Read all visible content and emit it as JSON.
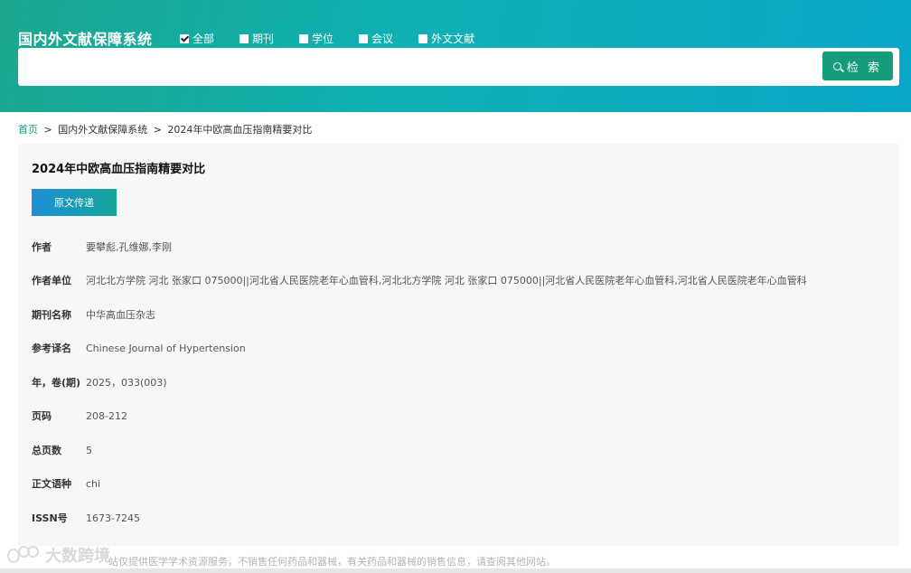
{
  "header": {
    "logo_text": "国内外文献保障系统",
    "filters": [
      {
        "label": "全部",
        "checked": true
      },
      {
        "label": "期刊",
        "checked": false
      },
      {
        "label": "学位",
        "checked": false
      },
      {
        "label": "会议",
        "checked": false
      },
      {
        "label": "外文文献",
        "checked": false
      }
    ],
    "search": {
      "value": "",
      "placeholder": "",
      "button_label": "检 索"
    }
  },
  "breadcrumb": {
    "home": "首页",
    "separator": ">",
    "level1": "国内外文献保障系统",
    "current": "2024年中欧高血压指南精要对比"
  },
  "article": {
    "title": "2024年中欧高血压指南精要对比",
    "delivery_button": "原文传递",
    "fields": [
      {
        "label": "作者",
        "value": "要攀彪,孔维娜,李刚"
      },
      {
        "label": "作者单位",
        "value": "河北北方学院 河北 张家口 075000||河北省人民医院老年心血管科,河北北方学院 河北 张家口 075000||河北省人民医院老年心血管科,河北省人民医院老年心血管科"
      },
      {
        "label": "期刊名称",
        "value": "中华高血压杂志"
      },
      {
        "label": "参考译名",
        "value": "Chinese Journal of Hypertension"
      },
      {
        "label": "年，卷(期)",
        "value": "2025，033(003)"
      },
      {
        "label": "页码",
        "value": "208-212"
      },
      {
        "label": "总页数",
        "value": "5"
      },
      {
        "label": "正文语种",
        "value": "chi"
      },
      {
        "label": "ISSN号",
        "value": "1673-7245"
      }
    ]
  },
  "footer": {
    "text": "站仅提供医学学术资源服务，不销售任何药品和器械，有关药品和器械的销售信息，请查阅其他网站。",
    "watermark": "大数跨境"
  },
  "colors": {
    "header_gradient_start": "#1aa88e",
    "header_gradient_end": "#0aa7c9",
    "search_button": "#159c7c",
    "breadcrumb_link": "#159c7c",
    "panel_bg": "#f7f7f7"
  }
}
